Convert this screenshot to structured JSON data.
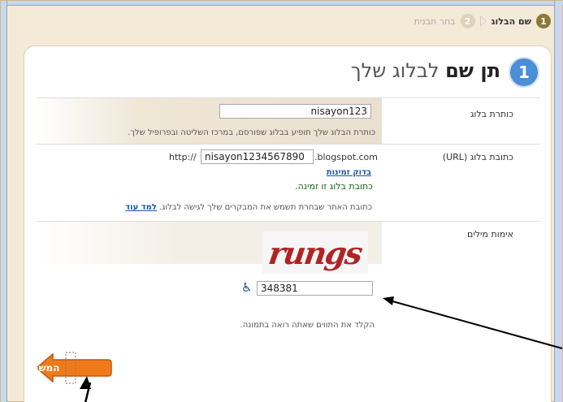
{
  "steps": [
    {
      "num": "1",
      "label": "שם הבלוג",
      "active": true
    },
    {
      "num": "2",
      "label": "בחר תבנית",
      "active": false
    }
  ],
  "header": {
    "step_num": "1",
    "title_bold": "תן שם",
    "title_rest": " לבלוג שלך"
  },
  "blog_title": {
    "label": "כותרת בלוג",
    "value": "nisayon123",
    "hint": "כותרת הבלוג שלך תופיע בבלוג שפורסם, במרכז השליטה ובפרופיל שלך."
  },
  "blog_address": {
    "label": "כתובת בלוג (URL)",
    "prefix": "http://",
    "value": "nisayon1234567890",
    "suffix": ".blogspot.com",
    "check_link": "בדוק זמינות",
    "available_msg": "כתובת בלוג זו זמינה.",
    "hint": "כתובת האתר שבחרת תשמש את המבקרים שלך לגישה לבלוג.",
    "learn_more": "למד עוד"
  },
  "word_verification": {
    "label": "אימות מילים",
    "captcha_text": "rungs",
    "value": "348381",
    "hint": "הקלד את התווים שאתה רואה בתמונה."
  },
  "continue_button": {
    "label": "המשך"
  },
  "colors": {
    "accent_blue": "#4b8fd6",
    "button_orange": "#f07a1a",
    "link_blue": "#1a55aa"
  }
}
